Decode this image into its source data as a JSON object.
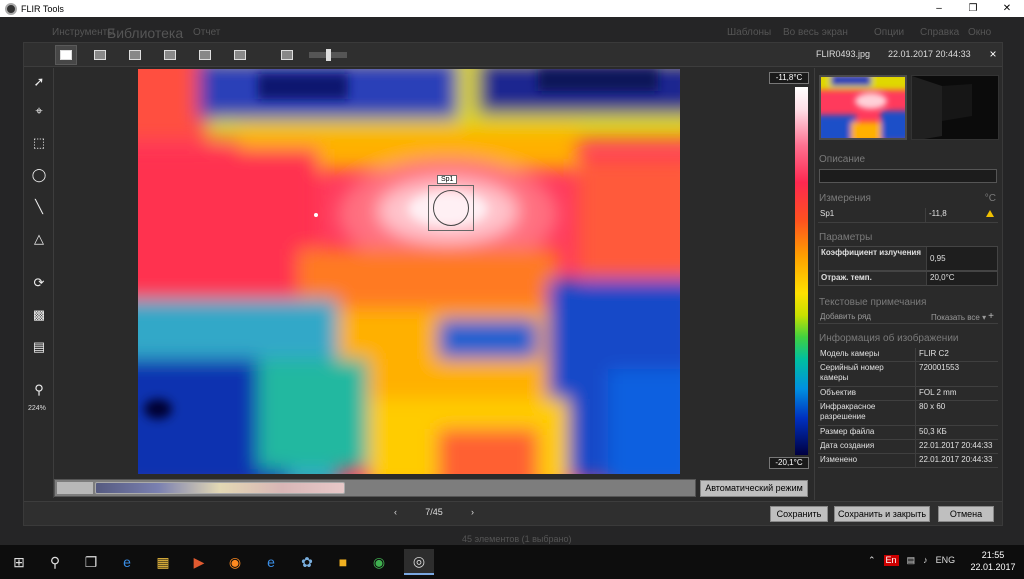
{
  "window": {
    "title": "FLIR Tools"
  },
  "background_app": {
    "menu": [
      "Инструменты",
      "Шаблоны",
      "Во весь экран",
      "Опции",
      "Справка",
      "Окно"
    ],
    "title": "Библиотека",
    "subtitle": "Отчет",
    "status": "45 элементов   (1 выбрано)"
  },
  "dialog": {
    "filename": "FLIR0493.jpg",
    "datetime": "22.01.2017 20:44:33",
    "close_glyph": "×",
    "zoom_level": "224%",
    "scale_max": "-11,8°C",
    "scale_min": "-20,1°C",
    "spot_label": "Sp1",
    "auto_mode_button": "Автоматический режим",
    "pager": {
      "prev": "‹",
      "current": "7/45",
      "next": "›"
    },
    "buttons": {
      "save": "Сохранить",
      "save_close": "Сохранить и закрыть",
      "cancel": "Отмена"
    }
  },
  "panel": {
    "description_header": "Описание",
    "measurements_header": "Измерения",
    "measurements_unit": "°C",
    "measurements": [
      {
        "name": "Sp1",
        "value": "-11,8",
        "warning": true
      }
    ],
    "parameters_header": "Параметры",
    "parameters": [
      {
        "name": "Коэффициент излучения",
        "value": "0,95"
      },
      {
        "name": "Отраж. темп.",
        "value": "20,0°C"
      }
    ],
    "show_all": "Показать все ▾",
    "notes_header": "Текстовые примечания",
    "add_row": "Добавить ряд",
    "add_glyph": "+",
    "info_header": "Информация об изображении",
    "info": [
      {
        "name": "Модель камеры",
        "value": "FLIR C2"
      },
      {
        "name": "Серийный номер камеры",
        "value": "720001553"
      },
      {
        "name": "Объектив",
        "value": "FOL 2 mm"
      },
      {
        "name": "Инфракрасное разрешение",
        "value": "80 x 60"
      },
      {
        "name": "Размер файла",
        "value": "50,3 КБ"
      },
      {
        "name": "Дата создания",
        "value": "22.01.2017 20:44:33"
      },
      {
        "name": "Изменено",
        "value": "22.01.2017 20:44:33"
      }
    ]
  },
  "taskbar": {
    "tray_lang": "ENG",
    "tray_input": "En",
    "time": "21:55",
    "date": "22.01.2017"
  }
}
